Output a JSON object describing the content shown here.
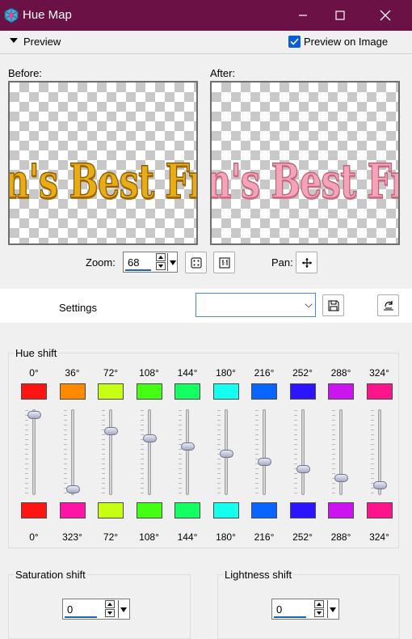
{
  "window": {
    "title": "Hue Map"
  },
  "preview": {
    "section_label": "Preview",
    "preview_on_image_label": "Preview on Image",
    "preview_on_image_checked": true,
    "before_label": "Before:",
    "after_label": "After:",
    "image_text": "an's Best Frien"
  },
  "zoom": {
    "label": "Zoom:",
    "value": "68",
    "pan_label": "Pan:"
  },
  "settings": {
    "label": "Settings",
    "preset_value": ""
  },
  "hue_shift": {
    "title": "Hue shift",
    "top_labels": [
      "0°",
      "36°",
      "72°",
      "108°",
      "144°",
      "180°",
      "216°",
      "252°",
      "288°",
      "324°"
    ],
    "top_colors": [
      "#ff1414",
      "#ff8a00",
      "#c6ff14",
      "#44ff14",
      "#14ff62",
      "#14fff0",
      "#0a64ff",
      "#2c14ff",
      "#cc14f0",
      "#ff148c"
    ],
    "bottom_colors": [
      "#ff1414",
      "#ff14a8",
      "#c6ff14",
      "#44ff14",
      "#14ff62",
      "#14fff0",
      "#0a64ff",
      "#2c14ff",
      "#cc14f0",
      "#ff148c"
    ],
    "bottom_labels": [
      "0°",
      "323°",
      "72°",
      "108°",
      "144°",
      "180°",
      "216°",
      "252°",
      "288°",
      "324°"
    ],
    "slider_levels": [
      0.07,
      0.93,
      0.25,
      0.34,
      0.43,
      0.52,
      0.61,
      0.7,
      0.8,
      0.89
    ]
  },
  "saturation_shift": {
    "title": "Saturation shift",
    "value": "0"
  },
  "lightness_shift": {
    "title": "Lightness shift",
    "value": "0"
  }
}
